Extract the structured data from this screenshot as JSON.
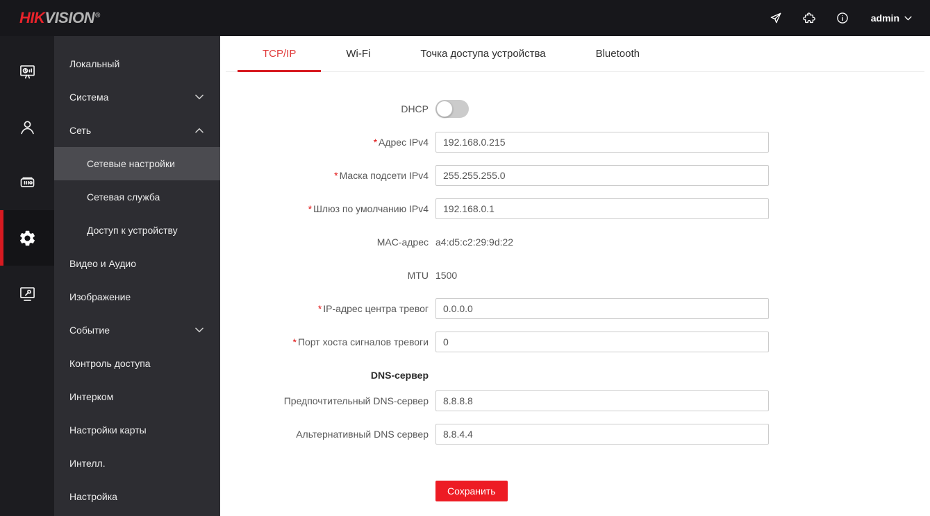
{
  "topbar": {
    "logo": {
      "hik": "HIK",
      "vision": "VISION",
      "reg": "®"
    },
    "icons": [
      "send-icon",
      "plugin-icon",
      "info-icon"
    ],
    "user": "admin"
  },
  "rail": {
    "items": [
      {
        "icon": "dashboard-icon",
        "active": false
      },
      {
        "icon": "user-icon",
        "active": false
      },
      {
        "icon": "access-terminal-icon",
        "active": false
      },
      {
        "icon": "gear-icon",
        "active": true
      },
      {
        "icon": "maintenance-icon",
        "active": false
      }
    ]
  },
  "sidebar": {
    "items": [
      {
        "label": "Локальный"
      },
      {
        "label": "Система",
        "chevron": "down"
      },
      {
        "label": "Сеть",
        "chevron": "up",
        "expanded": true
      },
      {
        "label": "Сетевые настройки",
        "sub": true,
        "selected": true
      },
      {
        "label": "Сетевая служба",
        "sub": true
      },
      {
        "label": "Доступ к устройству",
        "sub": true
      },
      {
        "label": "Видео и Аудио"
      },
      {
        "label": "Изображение"
      },
      {
        "label": "Событие",
        "chevron": "down"
      },
      {
        "label": "Контроль доступа"
      },
      {
        "label": "Интерком"
      },
      {
        "label": "Настройки карты"
      },
      {
        "label": "Интелл."
      },
      {
        "label": "Настройка"
      }
    ]
  },
  "tabs": [
    {
      "label": "TCP/IP",
      "active": true
    },
    {
      "label": "Wi-Fi",
      "active": false
    },
    {
      "label": "Точка доступа устройства",
      "active": false
    },
    {
      "label": "Bluetooth",
      "active": false
    }
  ],
  "form": {
    "required_marker": "*",
    "dhcp": {
      "label": "DHCP",
      "enabled": false
    },
    "fields": {
      "ipv4": {
        "label": "Адрес IPv4",
        "required": true,
        "value": "192.168.0.215"
      },
      "mask": {
        "label": "Маска подсети IPv4",
        "required": true,
        "value": "255.255.255.0"
      },
      "gateway": {
        "label": "Шлюз по умолчанию IPv4",
        "required": true,
        "value": "192.168.0.1"
      },
      "mac": {
        "label": "MAC-адрес",
        "value": "a4:d5:c2:29:9d:22"
      },
      "mtu": {
        "label": "MTU",
        "value": "1500"
      },
      "alarm_ip": {
        "label": "IP-адрес центра тревог",
        "required": true,
        "value": "0.0.0.0"
      },
      "alarm_port": {
        "label": "Порт хоста сигналов тревоги",
        "required": true,
        "value": "0"
      },
      "dns_heading": "DNS-сервер",
      "dns_preferred": {
        "label": "Предпочтительный DNS-сервер",
        "value": "8.8.8.8"
      },
      "dns_alternate": {
        "label": "Альтернативный DNS сервер",
        "value": "8.8.4.4"
      }
    },
    "save_label": "Сохранить"
  },
  "colors": {
    "brand_red": "#e8232b",
    "tab_active_red": "#e03a3a",
    "underline_red": "#d71a21",
    "save_button_red": "#ed1c24",
    "sidebar_bg": "#2d2d32",
    "sidebar_selected_bg": "#4b4b50",
    "rail_bg": "#1c1c20",
    "topbar_bg": "#17171b"
  }
}
